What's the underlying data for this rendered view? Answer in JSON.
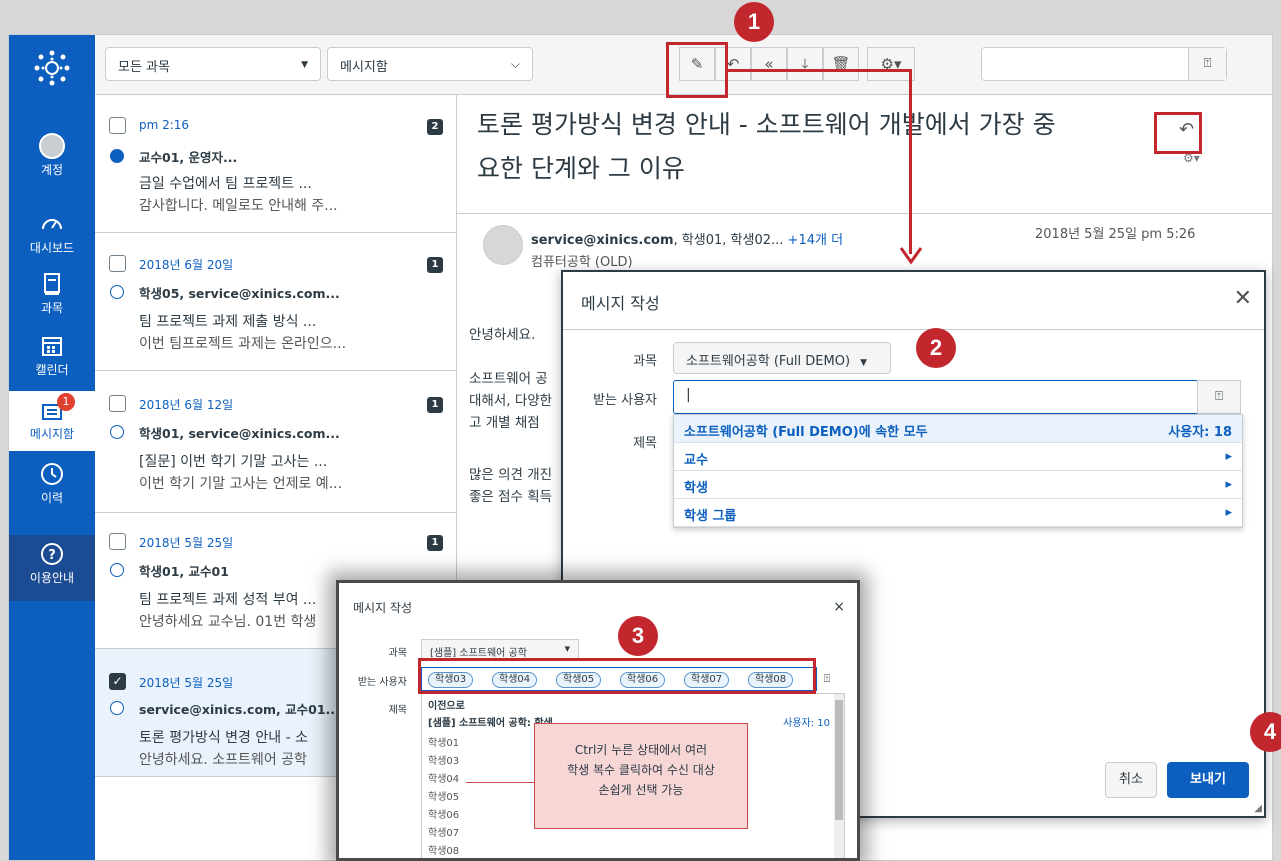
{
  "nav": {
    "items": [
      {
        "label": "계정"
      },
      {
        "label": "대시보드"
      },
      {
        "label": "과목"
      },
      {
        "label": "캘린더"
      },
      {
        "label": "메시지함",
        "badge": "1"
      },
      {
        "label": "이력"
      },
      {
        "label": "이용안내"
      }
    ]
  },
  "toolbar": {
    "course_filter": "모든 과목",
    "mailbox_filter": "메시지함"
  },
  "messages": [
    {
      "date": "pm 2:16",
      "count": "2",
      "from": "교수01, 운영자...",
      "subject": "금일 수업에서 팀 프로젝트 ...",
      "preview": "감사합니다. 메일로도 안내해 주..."
    },
    {
      "date": "2018년 6월 20일",
      "count": "1",
      "from": "학생05, service@xinics.com...",
      "subject": "팀 프로젝트 과제 제출 방식 ...",
      "preview": "이번 팀프로젝트 과제는 온라인으..."
    },
    {
      "date": "2018년 6월 12일",
      "count": "1",
      "from": "학생01, service@xinics.com...",
      "subject": "[질문] 이번 학기 기말 고사는 ...",
      "preview": "이번 학기 기말 고사는 언제로 예..."
    },
    {
      "date": "2018년 5월 25일",
      "count": "1",
      "from": "학생01, 교수01",
      "subject": "팀 프로젝트 과제 성적 부여 ...",
      "preview": "안녕하세요 교수님. 01번 학생"
    },
    {
      "date": "2018년 5월 25일",
      "count": "",
      "from": "service@xinics.com, 교수01...",
      "subject": "토론 평가방식 변경 안내 - 소",
      "preview": "안녕하세요. 소프트웨어 공학"
    }
  ],
  "reading": {
    "title_line1": "토론 평가방식 변경 안내 - 소프트웨어 개발에서 가장 중",
    "title_line2": "요한 단계와 그 이유",
    "sender_bold": "service@xinics.com",
    "sender_rest": ", 학생01, 학생02...",
    "sender_more": "+14개 더",
    "course": "컴퓨터공학 (OLD)",
    "date": "2018년 5월 25일 pm 5:26",
    "body": [
      "안녕하세요.",
      "소프트웨어 공",
      "대해서, 다양한",
      "고 개별 채점 ",
      "많은 의견 개진",
      "좋은 점수 획득"
    ]
  },
  "compose": {
    "title": "메시지 작성",
    "course_label": "과목",
    "course_value": "소프트웨어공학 (Full DEMO)",
    "to_label": "받는 사용자",
    "to_value": "|",
    "subject_label": "제목",
    "dropdown": [
      {
        "label": "소프트웨어공학 (Full DEMO)에 속한 모두",
        "right": "사용자: 18"
      },
      {
        "label": "교수",
        "right": "▸"
      },
      {
        "label": "학생",
        "right": "▸"
      },
      {
        "label": "학생 그룹",
        "right": "▸"
      }
    ],
    "cancel": "취소",
    "send": "보내기"
  },
  "compose2": {
    "title": "메시지 작성",
    "course_label": "과목",
    "course_value": "[샘플] 소프트웨어 공학",
    "to_label": "받는 사용자",
    "subject_label": "제목",
    "tokens": [
      "학생03",
      "학생04",
      "학생05",
      "학생06",
      "학생07",
      "학생08"
    ],
    "back": "이전으로",
    "list_header": "[샘플] 소프트웨어 공학: 학생",
    "list_count": "사용자: 10",
    "students": [
      "학생01",
      "학생03",
      "학생04",
      "학생05",
      "학생06",
      "학생07",
      "학생08"
    ]
  },
  "note": {
    "line1": "Ctrl키 누른 상태에서 여러",
    "line2": "학생 복수 클릭하여 수신 대상",
    "line3": "손쉽게 선택 가능"
  },
  "annotations": [
    "1",
    "2",
    "3",
    "4"
  ],
  "colors": {
    "brand": "#0d5fbf",
    "annotation": "#c1272d",
    "note_bg": "#f7d6d6"
  }
}
